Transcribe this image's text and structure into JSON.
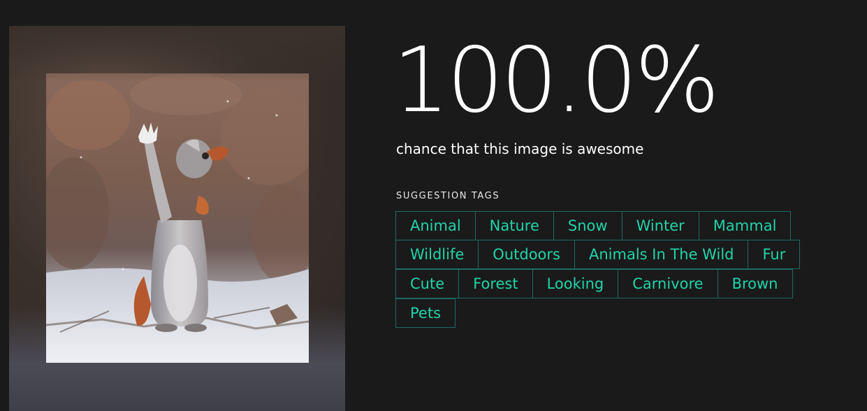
{
  "image": {
    "subject_icon": "squirrel-photo"
  },
  "result": {
    "score": "100.0%",
    "subtitle": "chance that this image is awesome"
  },
  "tags": {
    "heading": "SUGGESTION TAGS",
    "rows": [
      [
        "Animal",
        "Nature",
        "Snow",
        "Winter",
        "Mammal"
      ],
      [
        "Wildlife",
        "Outdoors",
        "Animals In The Wild",
        "Fur"
      ],
      [
        "Cute",
        "Forest",
        "Looking",
        "Carnivore",
        "Brown"
      ],
      [
        "Pets"
      ]
    ]
  },
  "colors": {
    "background": "#1a1a1a",
    "tag_text": "#21d4a8",
    "tag_border": "#1d6b63",
    "score_text": "#ffffff"
  }
}
